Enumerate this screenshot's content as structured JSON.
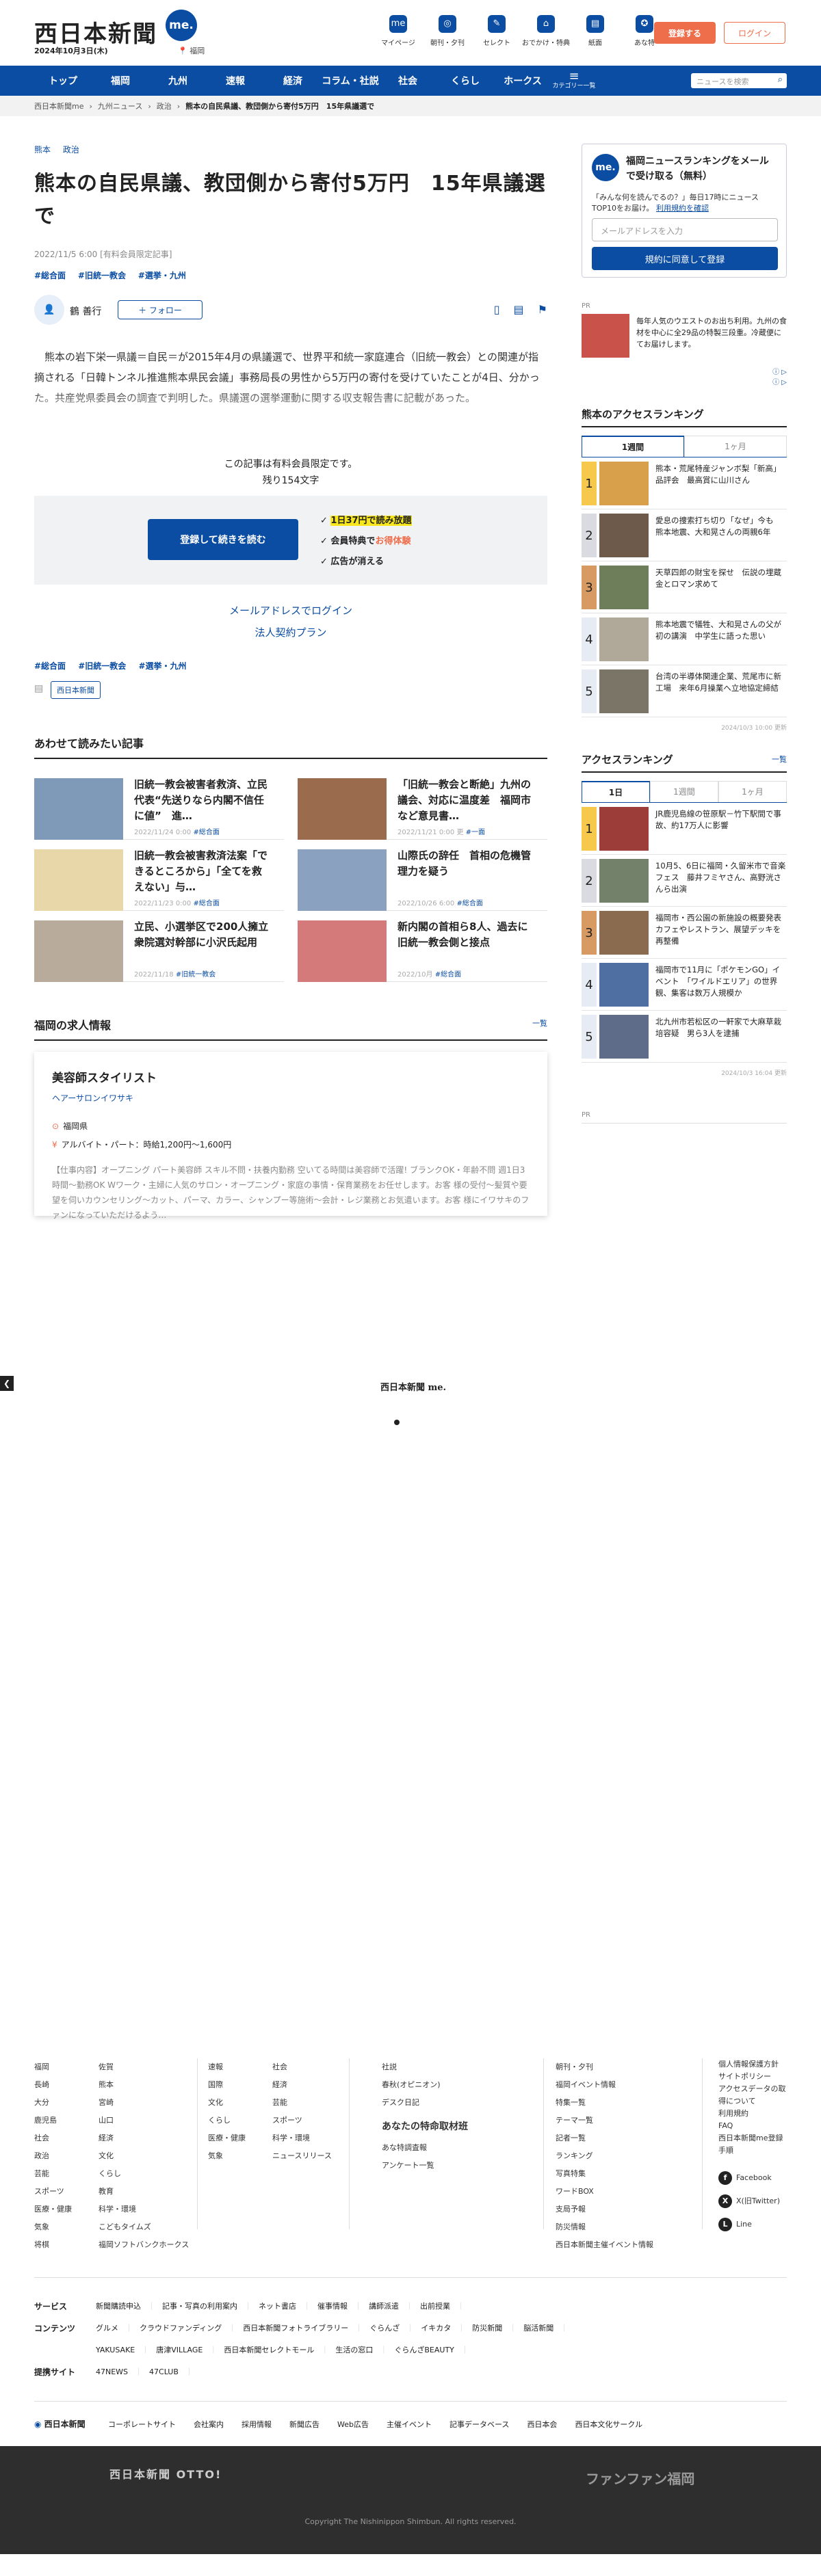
{
  "header": {
    "logo": "西日本新聞",
    "logo_me": "me.",
    "date": "2024年10月3日(木)",
    "pref": "福岡",
    "nav": [
      {
        "label": "マイページ",
        "icon": "me"
      },
      {
        "label": "朝刊・夕刊",
        "icon": "◎"
      },
      {
        "label": "セレクト",
        "icon": "✎"
      },
      {
        "label": "おでかけ・特典",
        "icon": "⌂"
      },
      {
        "label": "紙面",
        "icon": "▤"
      },
      {
        "label": "あな特",
        "icon": "✪"
      }
    ],
    "register": "登録する",
    "login": "ログイン"
  },
  "gnav": {
    "items": [
      "トップ",
      "福岡",
      "九州",
      "速報",
      "経済",
      "コラム・社説",
      "社会",
      "くらし",
      "ホークス"
    ],
    "menu_label": "カテゴリー一覧",
    "search_placeholder": "ニュースを検索"
  },
  "breadcrumb": [
    "西日本新聞me",
    "九州ニュース",
    "政治",
    "熊本の自民県議、教団側から寄付5万円　15年県議選で"
  ],
  "article": {
    "categories": [
      "熊本",
      "政治"
    ],
    "title": "熊本の自民県議、教団側から寄付5万円　15年県議選で",
    "meta": "2022/11/5 6:00 [有料会員限定記事]",
    "tags": [
      "#総合面",
      "#旧統一教会",
      "#選挙・九州"
    ],
    "author": "鶴 善行",
    "follow": "＋ フォロー",
    "body": "　熊本の岩下栄一県議＝自民＝が2015年4月の県議選で、世界平和統一家庭連合（旧統一教会）との関連が指摘される「日韓トンネル推進熊本県民会議」事務局長の男性から5万円の寄付を受けていたことが4日、分かった。共産党県委員会の調査で判明した。県議選の選挙運動に関する収支報告書に記載があった。",
    "paywall_line1": "この記事は有料会員限定です。",
    "paywall_line2": "残り154文字",
    "paywall_btn": "登録して続きを読む",
    "benefit1": "1日37円で読み放題",
    "benefit2a": "会員特典で",
    "benefit2b": "お得体験",
    "benefit3": "広告が消える",
    "mail_login": "メールアドレスでログイン",
    "corp_plan": "法人契約プラン",
    "tags2": [
      "#総合面",
      "#旧統一教会",
      "#選挙・九州"
    ],
    "source": "西日本新聞"
  },
  "related": {
    "heading": "あわせて読みたい記事",
    "items": [
      {
        "title": "旧統一教会被害者救済、立民代表“先送りなら内閣不信任に値”　進…",
        "date": "2022/11/24 0:00",
        "tag": "#総合面",
        "color": "#7f9ab8"
      },
      {
        "title": "「旧統一教会と断絶」九州の議会、対応に温度差　福岡市など意見書…",
        "date": "2022/11/21 0:00 更",
        "tag": "#一面",
        "color": "#9a6b4d"
      },
      {
        "title": "旧統一教会被害救済法案「できるところから」「全てを救えない」与…",
        "date": "2022/11/23 0:00",
        "tag": "#総合面",
        "color": "#e8d7a8"
      },
      {
        "title": "山際氏の辞任　首相の危機管理力を疑う",
        "date": "2022/10/26 6:00",
        "tag": "#総合面",
        "color": "#8aa2c0"
      },
      {
        "title": "立民、小選挙区で200人擁立　衆院選対幹部に小沢氏起用",
        "date": "2022/11/18",
        "tag": "#旧統一教会",
        "color": "#b9ab9c"
      },
      {
        "title": "新内閣の首相ら8人、過去に旧統一教会側と接点",
        "date": "2022/10月",
        "tag": "#総合面",
        "color": "#d47a7a"
      }
    ]
  },
  "jobs": {
    "heading": "福岡の求人情報",
    "more": "一覧",
    "title": "美容師スタイリスト",
    "company": "ヘアーサロンイワサキ",
    "location": "福岡県",
    "pay": "アルバイト・パート：時給1,200円〜1,600円",
    "desc": "【仕事内容】オープニング パート美容師 スキル不問・扶養内勤務 空いてる時間は美容師で活躍! ブランクOK・年齢不問 週1日3時間〜勤務OK Wワーク・主婦に人気のサロン・オープニング・家庭の事情・保育業務をお任せします。お客 様の受付〜髪質や要望を伺いカウンセリング〜カット、パーマ、カラー、シャンプー等施術〜会計・レジ業務とお気遣います。お客 様にイワサキのファンになっていただけるよう…"
  },
  "carousel": {
    "logo": "西日本新聞 me."
  },
  "sidebar": {
    "newsletter": {
      "title": "福岡ニュースランキングをメールで受け取る（無料）",
      "sub": "「みんな何を読んでるの？」毎日17時にニュースTOP10をお届け。",
      "link": "利用規約を確認",
      "placeholder": "メールアドレスを入力",
      "button": "規約に同意して登録"
    },
    "pr_label": "PR",
    "pr_text": "毎年人気のウエストのお出ち利用。九州の食材を中心に全29品の特製三段重。冷蔵便にてお届けします。",
    "ranking1": {
      "title": "熊本のアクセスランキング",
      "tabs": [
        "1週間",
        "1ヶ月"
      ],
      "items": [
        {
          "rank": "1",
          "text": "熊本・荒尾特産ジャンボ梨「新高」品評会　最高賞に山川さん",
          "color": "#d9a04c"
        },
        {
          "rank": "2",
          "text": "愛息の捜索打ち切り「なぜ」今も　熊本地震、大和晃さんの両親6年",
          "color": "#6d5a4b"
        },
        {
          "rank": "3",
          "text": "天草四郎の財宝を探せ　伝説の埋蔵金とロマン求めて",
          "color": "#6e7d5a"
        },
        {
          "rank": "4",
          "text": "熊本地震で犠牲、大和晃さんの父が初の講演　中学生に語った思い",
          "color": "#b0a898"
        },
        {
          "rank": "5",
          "text": "台湾の半導体関連企業、荒尾市に新工場　来年6月操業へ立地協定締結",
          "color": "#7a7566"
        }
      ],
      "updated": "2024/10/3 10:00 更新"
    },
    "ranking2": {
      "title": "アクセスランキング",
      "more": "一覧",
      "tabs": [
        "1日",
        "1週間",
        "1ヶ月"
      ],
      "items": [
        {
          "rank": "1",
          "text": "JR鹿児島線の笹原駅－竹下駅間で事故、約17万人に影響",
          "color": "#9c3d3a"
        },
        {
          "rank": "2",
          "text": "10月5、6日に福岡・久留米市で音楽フェス　藤井フミヤさん、高野洸さんら出演",
          "color": "#73816b"
        },
        {
          "rank": "3",
          "text": "福岡市・西公園の新施設の概要発表　カフェやレストラン、展望デッキを再整備",
          "color": "#8a6b50"
        },
        {
          "rank": "4",
          "text": "福岡市で11月に「ポケモンGO」イベント　「ワイルドエリア」の世界観、集客は数万人規模か",
          "color": "#4f6fa3"
        },
        {
          "rank": "5",
          "text": "北九州市若松区の一軒家で大麻草栽培容疑　男ら3人を逮捕",
          "color": "#5e6c8a"
        }
      ],
      "updated": "2024/10/3 16:04 更新"
    },
    "pr_label2": "PR"
  },
  "footer": {
    "col1a": [
      "福岡",
      "長崎",
      "大分",
      "鹿児島",
      "社会",
      "政治",
      "芸能",
      "スポーツ",
      "医療・健康",
      "気象",
      "将棋"
    ],
    "col1b": [
      "佐賀",
      "熊本",
      "宮崎",
      "山口",
      "経済",
      "文化",
      "くらし",
      "教育",
      "科学・環境",
      "こどもタイムズ",
      "福岡ソフトバンクホークス"
    ],
    "col2a": [
      "速報",
      "国際",
      "文化",
      "くらし",
      "医療・健康",
      "気象"
    ],
    "col2b": [
      "社会",
      "経済",
      "芸能",
      "スポーツ",
      "科学・環境",
      "ニュースリリース"
    ],
    "col3": [
      "社説",
      "春秋(オピニオン)",
      "デスク日記"
    ],
    "col3_head": "あなたの特命取材班",
    "col3b": [
      "あな特調査報",
      "アンケート一覧"
    ],
    "col4": [
      "朝刊・夕刊",
      "福岡イベント情報",
      "特集一覧",
      "テーマ一覧",
      "記者一覧",
      "ランキング",
      "写真特集",
      "ワードBOX",
      "支局予報",
      "防災情報",
      "西日本新聞主催イベント情報"
    ],
    "col5": [
      "個人情報保護方針",
      "サイトポリシー",
      "アクセスデータの取得について",
      "利用規約",
      "FAQ",
      "西日本新聞me登録手順"
    ],
    "social": [
      "Facebook",
      "X(旧Twitter)",
      "Line"
    ],
    "rows": [
      {
        "label": "サービス",
        "items": [
          "新聞購読申込",
          "記事・写真の利用案内",
          "ネット書店",
          "催事情報",
          "講師派遣",
          "出前授業"
        ]
      },
      {
        "label": "コンテンツ",
        "items": [
          "グルメ",
          "クラウドファンディング",
          "西日本新聞フォトライブラリー",
          "ぐらんざ",
          "イキカタ",
          "防災新聞",
          "脳活新聞"
        ]
      },
      {
        "label": "",
        "items": [
          "YAKUSAKE",
          "唐津VILLAGE",
          "西日本新聞セレクトモール",
          "生活の窓口",
          "ぐらんざBEAUTY"
        ]
      },
      {
        "label": "提携サイト",
        "items": [
          "47NEWS",
          "47CLUB"
        ]
      }
    ],
    "corp_logo": "西日本新聞",
    "corp": [
      "コーポレートサイト",
      "会社案内",
      "採用情報",
      "新聞広告",
      "Web広告",
      "主催イベント",
      "記事データベース",
      "西日本会",
      "西日本文化サークル"
    ],
    "dark_left": "西日本新聞 OTTO!",
    "dark_right": "ファンファン福岡",
    "copyright": "Copyright The Nishinippon Shimbun. All rights reserved."
  }
}
